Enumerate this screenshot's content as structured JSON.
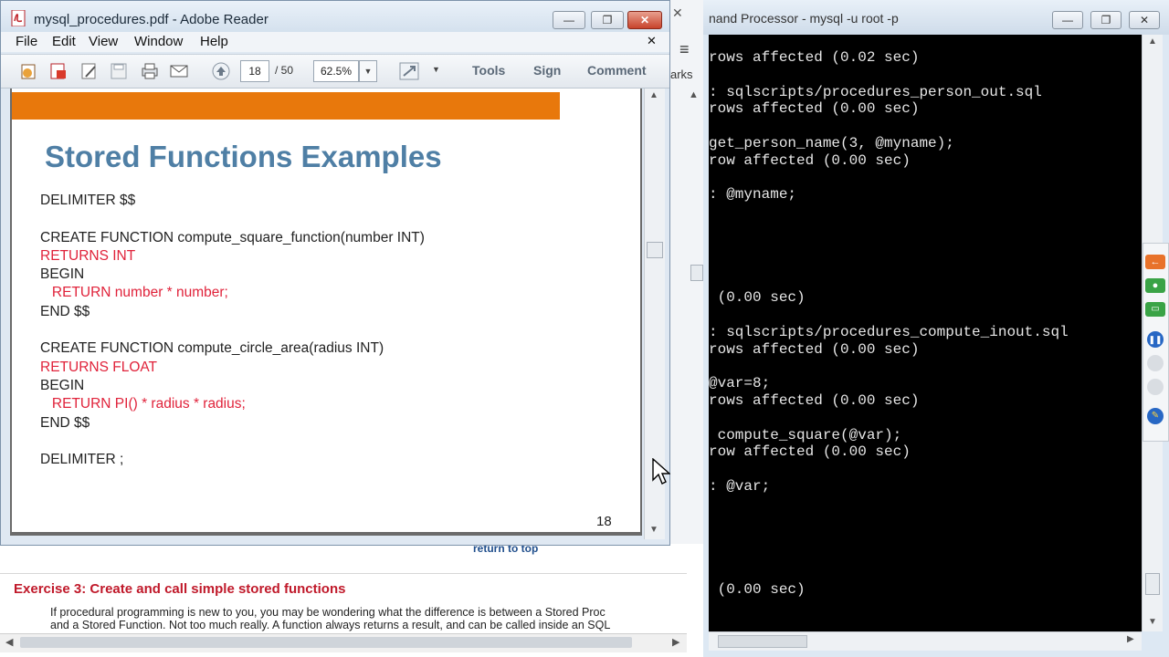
{
  "terminal": {
    "title": "nand Processor - mysql  -u root -p",
    "lines": [
      "rows affected (0.02 sec)",
      "",
      ": sqlscripts/procedures_person_out.sql",
      "rows affected (0.00 sec)",
      "",
      "get_person_name(3, @myname);",
      "row affected (0.00 sec)",
      "",
      ": @myname;",
      "",
      "",
      "",
      "",
      "",
      " (0.00 sec)",
      "",
      ": sqlscripts/procedures_compute_inout.sql",
      "rows affected (0.00 sec)",
      "",
      "@var=8;",
      "rows affected (0.00 sec)",
      "",
      " compute_square(@var);",
      "row affected (0.00 sec)",
      "",
      ": @var;",
      "",
      "",
      "",
      "",
      "",
      " (0.00 sec)"
    ]
  },
  "reader": {
    "title": "mysql_procedures.pdf - Adobe Reader",
    "menu": [
      "File",
      "Edit",
      "View",
      "Window",
      "Help"
    ],
    "page_current": "18",
    "page_total": "/ 50",
    "zoom": "62.5%",
    "tools": "Tools",
    "sign": "Sign",
    "comment": "Comment",
    "slide": {
      "heading": "Stored Functions Examples",
      "page_number": "18",
      "lines": [
        {
          "text": "DELIMITER $$",
          "color": "black"
        },
        {
          "text": "",
          "color": "black"
        },
        {
          "text": "CREATE FUNCTION compute_square_function(number INT)",
          "color": "black"
        },
        {
          "text": "RETURNS INT",
          "color": "red"
        },
        {
          "text": "BEGIN",
          "color": "black"
        },
        {
          "text": "   RETURN number * number;",
          "color": "red"
        },
        {
          "text": "END $$",
          "color": "black"
        },
        {
          "text": "",
          "color": "black"
        },
        {
          "text": "CREATE FUNCTION compute_circle_area(radius INT)",
          "color": "black"
        },
        {
          "text": "RETURNS FLOAT",
          "color": "red"
        },
        {
          "text": "BEGIN",
          "color": "black"
        },
        {
          "text": "   RETURN PI() * radius * radius;",
          "color": "red"
        },
        {
          "text": "END $$",
          "color": "black"
        },
        {
          "text": "",
          "color": "black"
        },
        {
          "text": "DELIMITER ;",
          "color": "black"
        }
      ]
    }
  },
  "doc": {
    "return_to_top": "return to top",
    "exercise_heading": "Exercise 3: Create and call simple stored functions",
    "para_line1": "If procedural programming is new to you, you may be wondering what the difference is between a Stored Proc",
    "para_line2": "and a Stored Function. Not too much really. A function always returns a result, and can be called inside an SQL"
  },
  "strip": {
    "marks_label": "arks"
  },
  "colors": {
    "accent_orange": "#e8780c",
    "heading_blue": "#4f7fa5",
    "code_red": "#e0223a"
  }
}
